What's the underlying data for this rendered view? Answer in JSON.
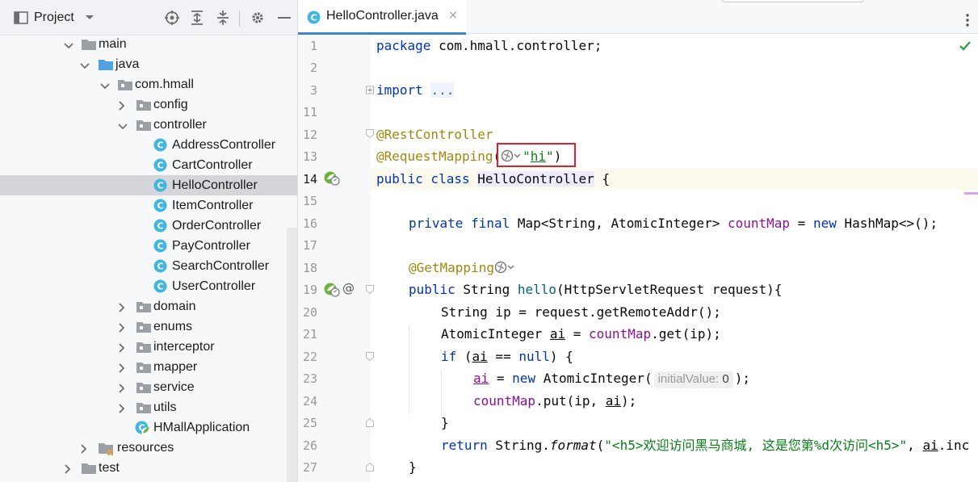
{
  "project_panel": {
    "title": "Project",
    "toolbar_icons": [
      "select-opened-file-icon",
      "expand-all-icon",
      "collapse-all-icon",
      "settings-icon",
      "hide-icon"
    ]
  },
  "tree": [
    {
      "label": "main",
      "type": "folder",
      "expanded": true,
      "depth": 0
    },
    {
      "label": "java",
      "type": "source-folder",
      "expanded": true,
      "depth": 1
    },
    {
      "label": "com.hmall",
      "type": "package",
      "expanded": true,
      "depth": 2
    },
    {
      "label": "config",
      "type": "package",
      "expanded": false,
      "depth": 3
    },
    {
      "label": "controller",
      "type": "package",
      "expanded": true,
      "depth": 3
    },
    {
      "label": "AddressController",
      "type": "class",
      "depth": 4
    },
    {
      "label": "CartController",
      "type": "class",
      "depth": 4
    },
    {
      "label": "HelloController",
      "type": "class",
      "depth": 4,
      "selected": true
    },
    {
      "label": "ItemController",
      "type": "class",
      "depth": 4
    },
    {
      "label": "OrderController",
      "type": "class",
      "depth": 4
    },
    {
      "label": "PayController",
      "type": "class",
      "depth": 4
    },
    {
      "label": "SearchController",
      "type": "class",
      "depth": 4
    },
    {
      "label": "UserController",
      "type": "class",
      "depth": 4
    },
    {
      "label": "domain",
      "type": "package",
      "expanded": false,
      "depth": 3
    },
    {
      "label": "enums",
      "type": "package",
      "expanded": false,
      "depth": 3
    },
    {
      "label": "interceptor",
      "type": "package",
      "expanded": false,
      "depth": 3
    },
    {
      "label": "mapper",
      "type": "package",
      "expanded": false,
      "depth": 3
    },
    {
      "label": "service",
      "type": "package",
      "expanded": false,
      "depth": 3
    },
    {
      "label": "utils",
      "type": "package",
      "expanded": false,
      "depth": 3
    },
    {
      "label": "HMallApplication",
      "type": "spring-class",
      "depth": 3
    },
    {
      "label": "resources",
      "type": "resources-folder",
      "expanded": false,
      "depth": 1
    },
    {
      "label": "test",
      "type": "folder",
      "expanded": false,
      "depth": 0
    }
  ],
  "editor": {
    "tab": {
      "label": "HelloController.java",
      "close": "×"
    },
    "line_numbers": [
      "1",
      "2",
      "3",
      "11",
      "12",
      "13",
      "14",
      "15",
      "16",
      "17",
      "18",
      "19",
      "20",
      "21",
      "22",
      "23",
      "24",
      "25",
      "26",
      "27"
    ],
    "code": {
      "l1_package": "package",
      "l1_name": " com.hmall.controller;",
      "l3_import": "import",
      "l3_dots": "...",
      "l12_anno": "@RestController",
      "l13_anno": "@RequestMapping",
      "l13_open": "(",
      "l13_q1": "\"",
      "l13_val": "hi",
      "l13_q2": "\"",
      "l13_close": ")",
      "l14_public": "public",
      "l14_class": " class ",
      "l14_name": "HelloController",
      "l14_rest": " {",
      "l16_private": "private",
      "l16_final": " final ",
      "l16_type": "Map<String, AtomicInteger> ",
      "l16_field": "countMap",
      "l16_eq": " = ",
      "l16_new": "new",
      "l16_rest": " HashMap<>();",
      "l18_anno": "@GetMapping",
      "l19_public": "public",
      "l19_type": " String ",
      "l19_method": "hello",
      "l19_rest": "(HttpServletRequest request){",
      "l20": "String ip = request.getRemoteAddr();",
      "l21_type": "AtomicInteger ",
      "l21_var": "ai",
      "l21_eq": " = ",
      "l21_field": "countMap",
      "l21_rest": ".get(ip);",
      "l22_if": "if",
      "l22_open": " (",
      "l22_var": "ai",
      "l22_eq": " == ",
      "l22_null": "null",
      "l22_rest": ") {",
      "l23_var": "ai",
      "l23_eq": " = ",
      "l23_new": "new",
      "l23_rest": " AtomicInteger(",
      "l23_hint_name": "initialValue:",
      "l23_hint_val": "0",
      "l23_end": ");",
      "l24_field": "countMap",
      "l24_rest": ".put(ip, ",
      "l24_var": "ai",
      "l24_end": ");",
      "l25": "}",
      "l26_return": "return",
      "l26_cls": " String.",
      "l26_fmt": "format",
      "l26_open": "(",
      "l26_str": "\"<h5>欢迎访问黑马商城, 这是您第%d次访问<h5>\"",
      "l26_comma": ", ",
      "l26_var": "ai",
      "l26_rest": ".inc",
      "l27": "}"
    }
  },
  "colors": {
    "keyword": "#0033b3",
    "annotation": "#9e880d",
    "field": "#871094",
    "string": "#067d17",
    "method": "#00627a",
    "selection": "#d5d6d9",
    "accent": "#4083c9",
    "highlight_box": "#e0202a"
  }
}
